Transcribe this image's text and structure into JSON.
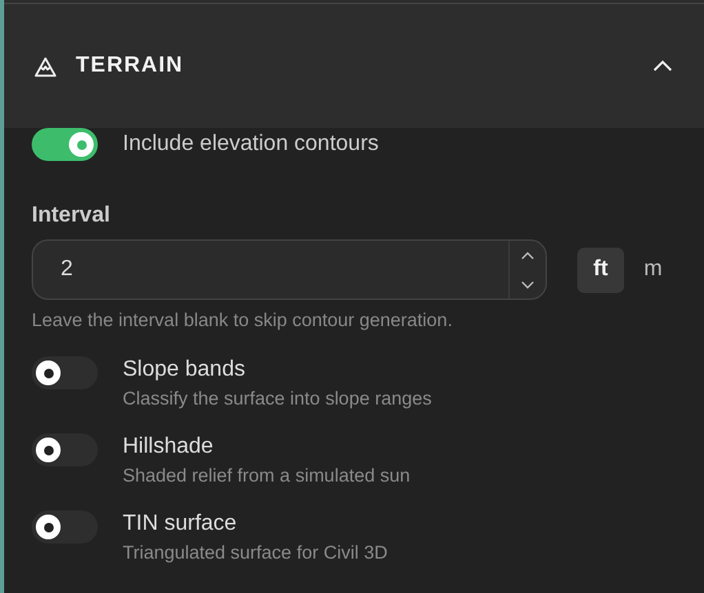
{
  "section": {
    "title": "TERRAIN",
    "expanded": true
  },
  "contours": {
    "label": "Include elevation contours",
    "on": true
  },
  "interval": {
    "label": "Interval",
    "value": "2",
    "help": "Leave the interval blank to skip contour generation.",
    "units": [
      {
        "label": "ft",
        "selected": true
      },
      {
        "label": "m",
        "selected": false
      }
    ]
  },
  "layers": [
    {
      "label": "Slope bands",
      "description": "Classify the surface into slope ranges",
      "on": false
    },
    {
      "label": "Hillshade",
      "description": "Shaded relief from a simulated sun",
      "on": false
    },
    {
      "label": "TIN surface",
      "description": "Triangulated surface for Civil 3D",
      "on": false
    }
  ]
}
